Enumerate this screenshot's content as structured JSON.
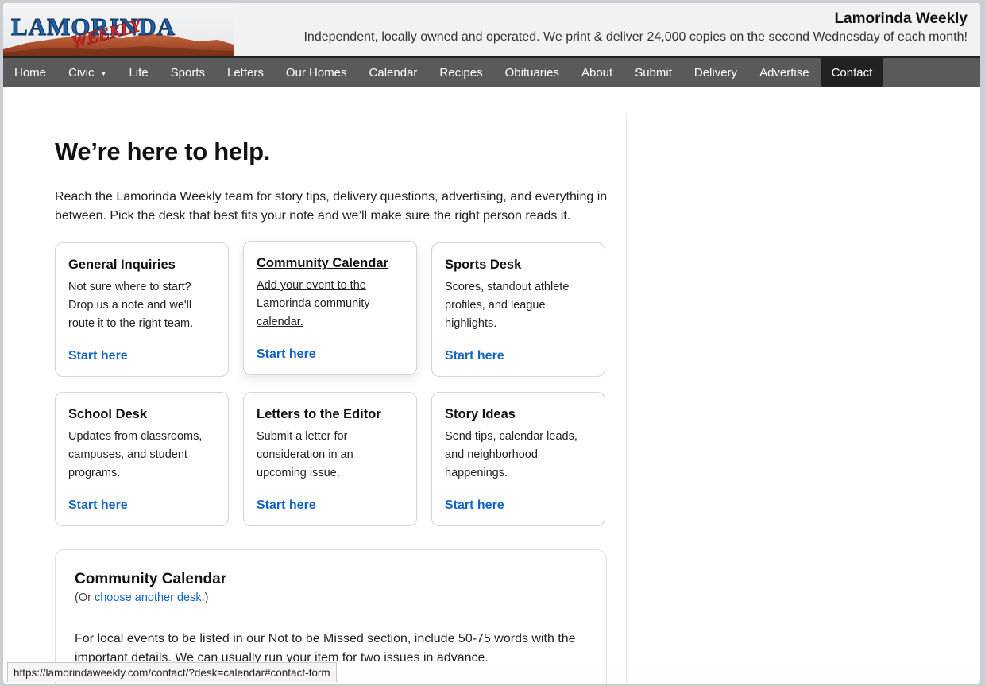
{
  "header": {
    "logo_text": "LAMORINDA",
    "logo_overlay": "WEEKLY",
    "site_name": "Lamorinda Weekly",
    "tagline": "Independent, locally owned and operated. We print & deliver 24,000 copies on the second Wednesday of each month!"
  },
  "nav": {
    "items": [
      {
        "label": "Home"
      },
      {
        "label": "Civic",
        "caret": "▼"
      },
      {
        "label": "Life"
      },
      {
        "label": "Sports"
      },
      {
        "label": "Letters"
      },
      {
        "label": "Our Homes"
      },
      {
        "label": "Calendar"
      },
      {
        "label": "Recipes"
      },
      {
        "label": "Obituaries"
      },
      {
        "label": "About"
      },
      {
        "label": "Submit"
      },
      {
        "label": "Delivery"
      },
      {
        "label": "Advertise"
      },
      {
        "label": "Contact"
      }
    ]
  },
  "main": {
    "title": "We’re here to help.",
    "intro": "Reach the Lamorinda Weekly team for story tips, delivery questions, advertising, and everything in between. Pick the desk that best fits your note and we’ll make sure the right person reads it.",
    "cards": [
      {
        "title": "General Inquiries",
        "desc": "Not sure where to start? Drop us a note and we'll route it to the right team.",
        "link": "Start here"
      },
      {
        "title": "Community Calendar",
        "desc": "Add your event to the Lamorinda community calendar.",
        "link": "Start here"
      },
      {
        "title": "Sports Desk",
        "desc": "Scores, standout athlete profiles, and league highlights.",
        "link": "Start here"
      },
      {
        "title": "School Desk",
        "desc": "Updates from classrooms, campuses, and student programs.",
        "link": "Start here"
      },
      {
        "title": "Letters to the Editor",
        "desc": "Submit a letter for consideration in an upcoming issue.",
        "link": "Start here"
      },
      {
        "title": "Story Ideas",
        "desc": "Send tips, calendar leads, and neighborhood happenings.",
        "link": "Start here"
      }
    ],
    "form": {
      "title": "Community Calendar",
      "sub_prefix": "(Or ",
      "sub_link": "choose another desk",
      "sub_suffix": ".)",
      "text": "For local events to be listed in our Not to be Missed section, include 50-75 words with the important details. We can usually run your item for two issues in advance."
    }
  },
  "status_bar": {
    "url": "https://lamorindaweekly.com/contact/?desk=calendar#contact-form"
  },
  "colors": {
    "nav_bg": "#5a5a5a",
    "nav_active": "#222222",
    "link_blue": "#1565c0",
    "logo_blue": "#1f5fa8",
    "logo_red": "#d42a2a"
  }
}
